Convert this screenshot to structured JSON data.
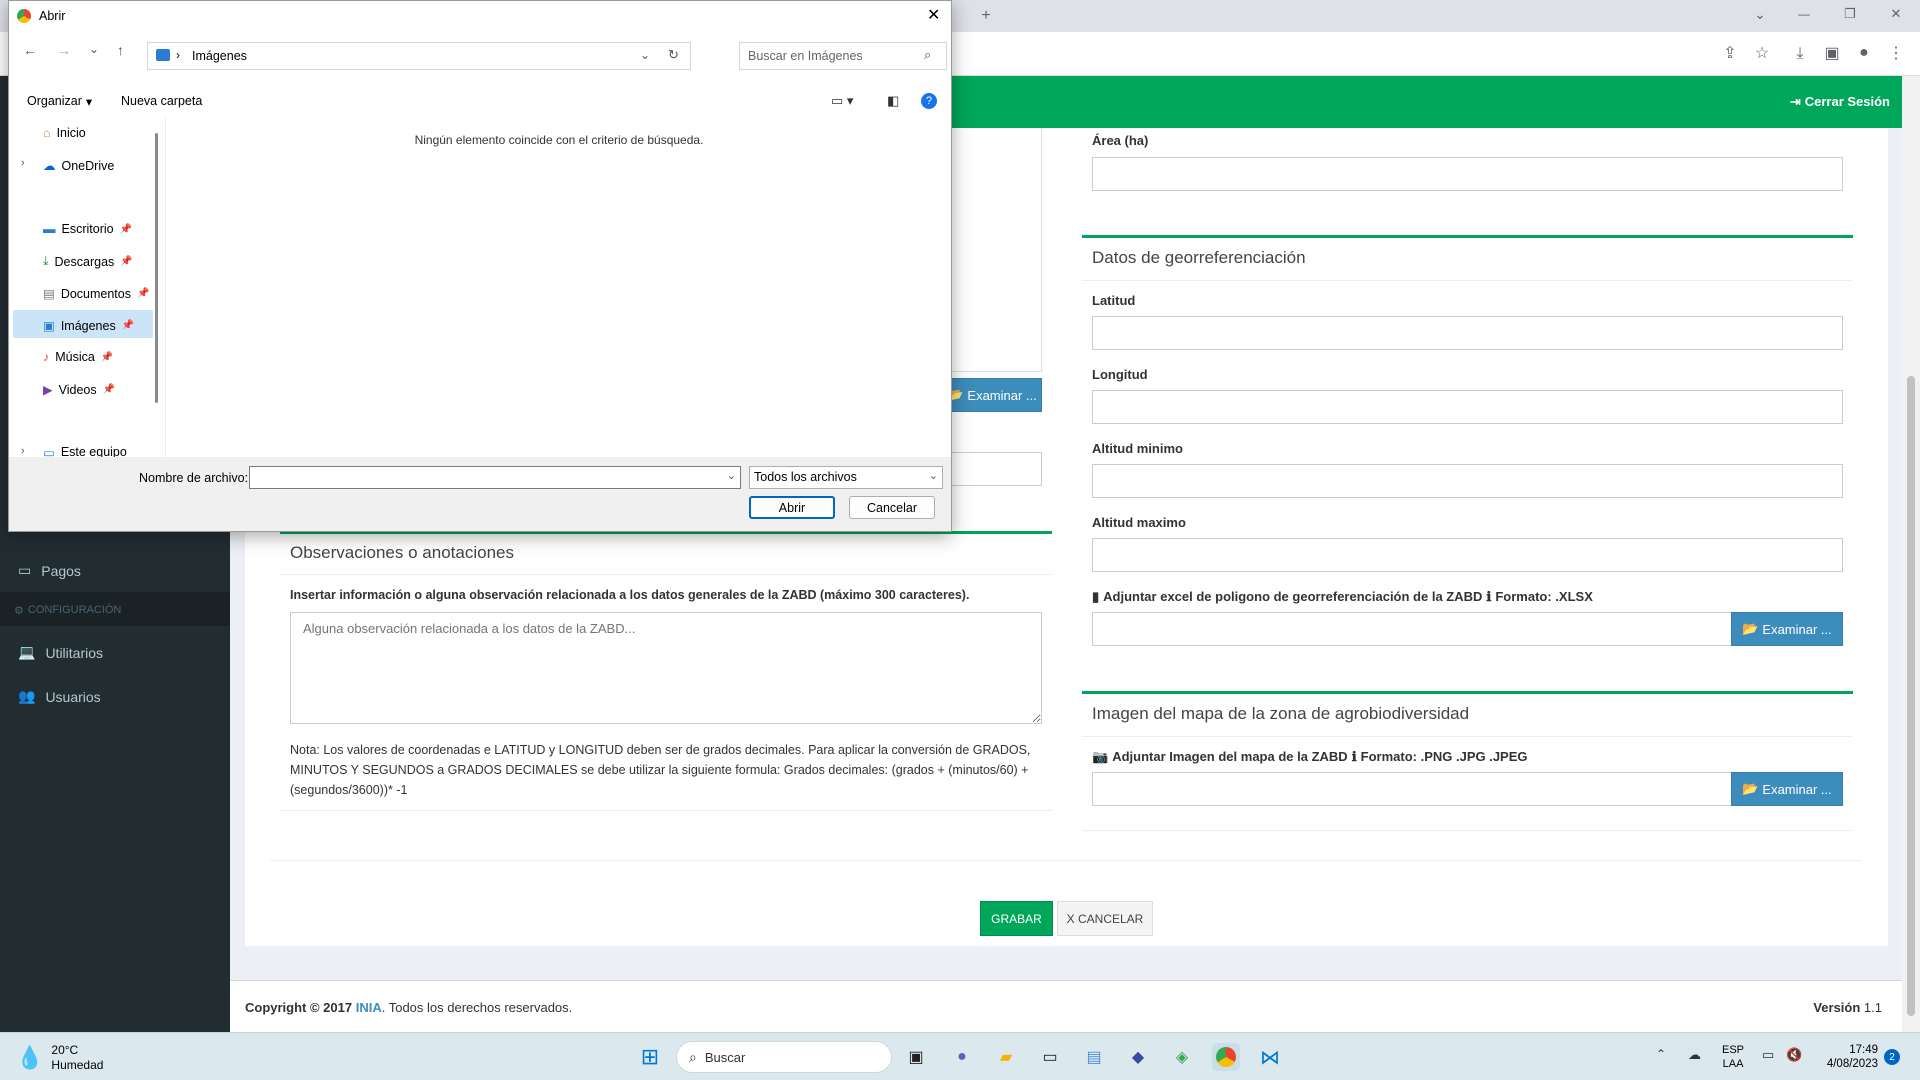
{
  "browser": {
    "new_tab": "+",
    "win_min": "—",
    "win_max": "❐",
    "win_close": "✕"
  },
  "app": {
    "logout": "Cerrar Sesión",
    "sidebar": {
      "pagos": "Pagos",
      "config_header": "CONFIGURACIÓN",
      "utilitarios": "Utilitarios",
      "usuarios": "Usuarios"
    },
    "left": {
      "examinar": "Examinar ...",
      "obs_title": "Observaciones o anotaciones",
      "obs_label": "Insertar información o alguna observación relacionada a los datos generales de la ZABD (máximo 300 caracteres).",
      "obs_placeholder": "Alguna observación relacionada a los datos de la ZABD...",
      "note": "Nota: Los valores de coordenadas e LATITUD y LONGITUD deben ser de grados decimales. Para aplicar la conversión de GRADOS, MINUTOS Y SEGUNDOS a GRADOS DECIMALES se debe utilizar la siguiente formula: Grados decimales: (grados + (minutos/60) + (segundos/3600))* -1"
    },
    "right": {
      "area_label": "Área (ha)",
      "geo_title": "Datos de georreferenciación",
      "latitud": "Latitud",
      "longitud": "Longitud",
      "alt_min": "Altitud minimo",
      "alt_max": "Altitud maximo",
      "excel_label": "Adjuntar excel de poligono de georreferenciación de la ZABD",
      "excel_format": "Formato: .XLSX",
      "examinar": "Examinar ...",
      "map_title": "Imagen del mapa de la zona de agrobiodiversidad",
      "map_label": "Adjuntar Imagen del mapa de la ZABD",
      "map_format": "Formato: .PNG .JPG .JPEG"
    },
    "grabar": "GRABAR",
    "cancelar": "X CANCELAR",
    "footer_copy": "Copyright © 2017",
    "footer_org": "INIA",
    "footer_rights": ". Todos los derechos reservados.",
    "version_label": "Versión",
    "version_value": "1.1"
  },
  "dialog": {
    "title": "Abrir",
    "breadcrumb": "Imágenes",
    "search_placeholder": "Buscar en Imágenes",
    "organizar": "Organizar",
    "nueva_carpeta": "Nueva carpeta",
    "empty_message": "Ningún elemento coincide con el criterio de búsqueda.",
    "nav": [
      {
        "label": "Inicio",
        "icon": "home-icon"
      },
      {
        "label": "OneDrive",
        "icon": "cloud-icon"
      },
      {
        "label": "Escritorio",
        "icon": "desktop-icon"
      },
      {
        "label": "Descargas",
        "icon": "download-icon"
      },
      {
        "label": "Documentos",
        "icon": "document-icon"
      },
      {
        "label": "Imágenes",
        "icon": "image-icon"
      },
      {
        "label": "Música",
        "icon": "music-icon"
      },
      {
        "label": "Videos",
        "icon": "video-icon"
      },
      {
        "label": "Este equipo",
        "icon": "computer-icon"
      }
    ],
    "filename_label": "Nombre de archivo:",
    "filetype": "Todos los archivos",
    "open_btn": "Abrir",
    "cancel_btn": "Cancelar"
  },
  "taskbar": {
    "weather_temp": "20°C",
    "weather_desc": "Humedad",
    "search": "Buscar",
    "lang1": "ESP",
    "lang2": "LAA",
    "time": "17:49",
    "date": "4/08/2023",
    "notif_count": "2"
  }
}
